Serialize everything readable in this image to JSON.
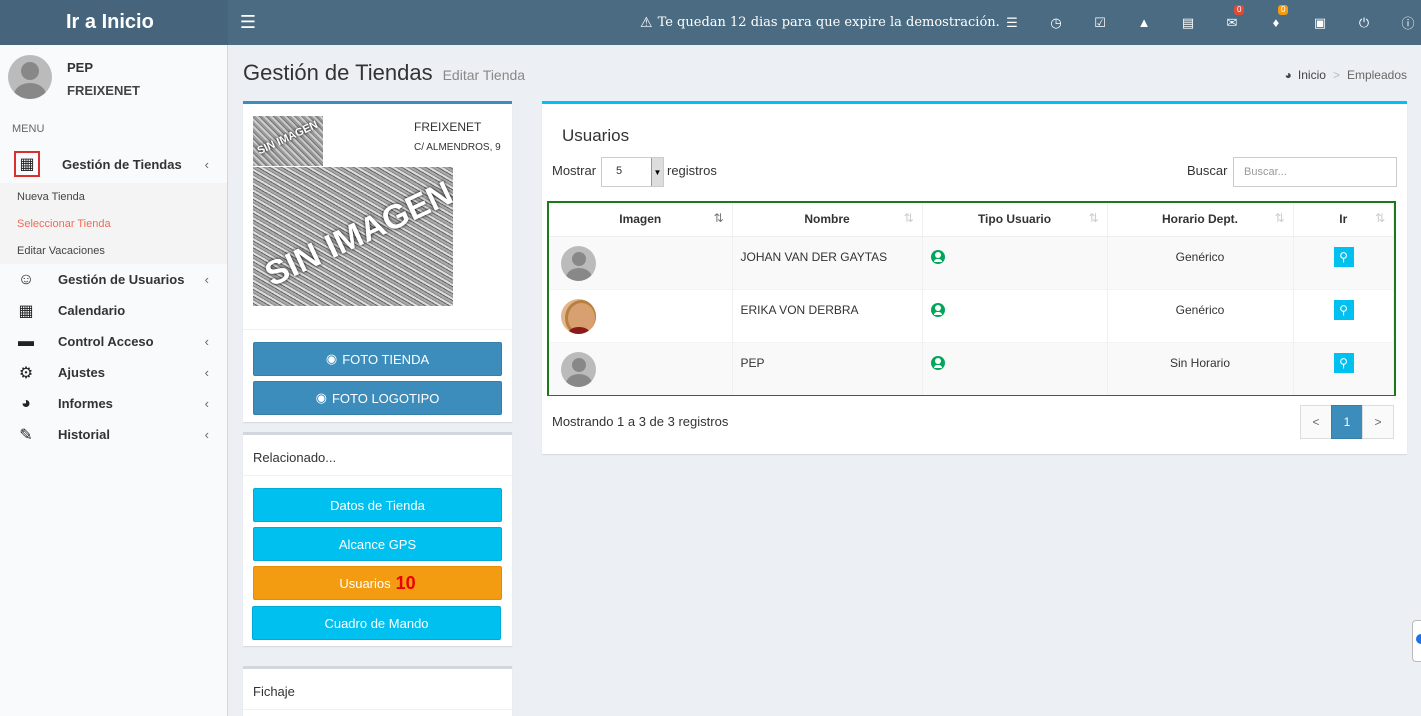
{
  "header": {
    "logo_text": "Ir a Inicio",
    "demo_message": "Te quedan 12 dias para que expire la demostración.",
    "icons": [
      "list-icon",
      "clock-icon",
      "calendar-check-icon",
      "road-icon",
      "newspaper-icon",
      "comments-icon",
      "bell-icon",
      "cart-icon",
      "power-icon",
      "help-icon"
    ],
    "comments_badge": "0",
    "bell_badge": "0"
  },
  "sidebar": {
    "user_name": "PEP",
    "user_company": "FREIXENET",
    "menu_header": "MENU",
    "items": [
      {
        "label": "Gestión de Tiendas",
        "icon": "building-icon"
      },
      {
        "label": "Gestión de Usuarios",
        "icon": "smile-icon"
      },
      {
        "label": "Calendario",
        "icon": "calendar-icon"
      },
      {
        "label": "Control Acceso",
        "icon": "credit-card-icon"
      },
      {
        "label": "Ajustes",
        "icon": "gear-icon"
      },
      {
        "label": "Informes",
        "icon": "pie-chart-icon"
      },
      {
        "label": "Historial",
        "icon": "edit-icon"
      }
    ],
    "submenu": [
      "Nueva Tienda",
      "Seleccionar Tienda",
      "Editar Vacaciones"
    ]
  },
  "page": {
    "title": "Gestión de Tiendas",
    "subtitle": "Editar Tienda",
    "breadcrumb_home": "Inicio",
    "breadcrumb_current": "Empleados"
  },
  "store": {
    "name": "FREIXENET",
    "address": "C/ ALMENDROS, 9",
    "image_placeholder": "SIN IMAGEN",
    "foto_tienda": "FOTO TIENDA",
    "foto_logotipo": "FOTO LOGOTIPO"
  },
  "related": {
    "title": "Relacionado...",
    "datos": "Datos de Tienda",
    "gps": "Alcance GPS",
    "usuarios": "Usuarios",
    "usuarios_count": "10",
    "cuadro": "Cuadro de Mando"
  },
  "fichaje": {
    "title": "Fichaje"
  },
  "users": {
    "title": "Usuarios",
    "show_label": "Mostrar",
    "page_size": "5",
    "records_label": "registros",
    "search_label": "Buscar",
    "search_placeholder": "Buscar...",
    "columns": [
      "Imagen",
      "Nombre",
      "Tipo Usuario",
      "Horario Dept.",
      "Ir"
    ],
    "rows": [
      {
        "name": "JOHAN VAN DER GAYTAS",
        "horario": "Genérico"
      },
      {
        "name": "ERIKA VON DERBRA",
        "horario": "Genérico"
      },
      {
        "name": "PEP",
        "horario": "Sin Horario"
      }
    ],
    "showing": "Mostrando 1 a 3 de 3 registros",
    "pagination": {
      "prev": "<",
      "current": "1",
      "next": ">"
    }
  }
}
